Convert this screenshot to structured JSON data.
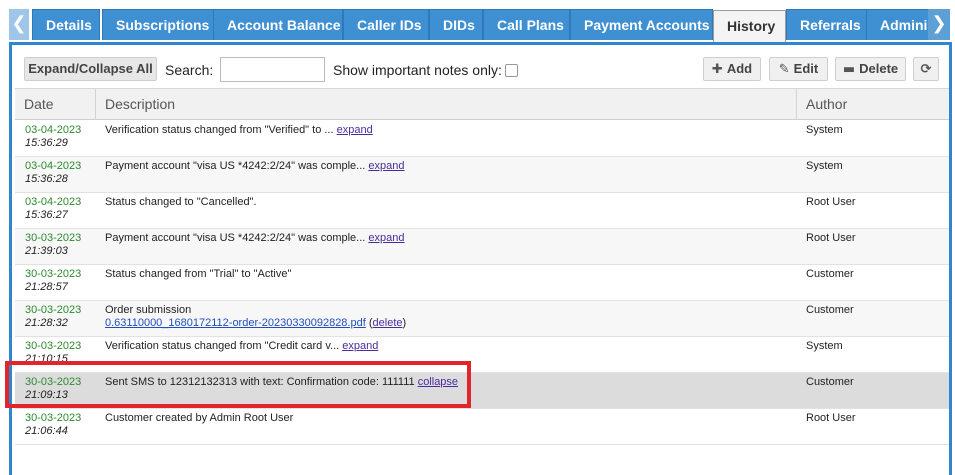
{
  "tabs": [
    {
      "label": "Details",
      "active": false
    },
    {
      "label": "Subscriptions",
      "active": false
    },
    {
      "label": "Account Balance",
      "active": false
    },
    {
      "label": "Caller IDs",
      "active": false
    },
    {
      "label": "DIDs",
      "active": false
    },
    {
      "label": "Call Plans",
      "active": false
    },
    {
      "label": "Payment Accounts",
      "active": false
    },
    {
      "label": "History",
      "active": true
    },
    {
      "label": "Referrals",
      "active": false
    },
    {
      "label": "Adminis",
      "active": false
    }
  ],
  "nav": {
    "left_icon": "chevron-left-icon",
    "left_glyph": "❮",
    "right_icon": "chevron-right-icon",
    "right_glyph": "❯"
  },
  "toolbar": {
    "expand_label": "Expand/Collapse All",
    "search_label": "Search:",
    "search_value": "",
    "important_label": "Show important notes only:",
    "important_checked": false,
    "add_label": "Add",
    "edit_label": "Edit",
    "delete_label": "Delete",
    "add_icon": "plus-icon",
    "edit_icon": "pencil-icon",
    "delete_icon": "minus-icon",
    "refresh_icon": "refresh-icon"
  },
  "grid": {
    "columns": [
      "Date",
      "Description",
      "Author"
    ],
    "rows": [
      {
        "date": "03-04-2023",
        "time": "15:36:29",
        "text": "Verification status changed from \"Verified\" to ... ",
        "link": "expand",
        "author": "System"
      },
      {
        "date": "03-04-2023",
        "time": "15:36:28",
        "text": "Payment account \"visa US *4242:2/24\" was comple... ",
        "link": "expand",
        "author": "System"
      },
      {
        "date": "03-04-2023",
        "time": "15:36:27",
        "text": "Status changed to \"Cancelled\".",
        "link": "",
        "author": "Root User"
      },
      {
        "date": "30-03-2023",
        "time": "21:39:03",
        "text": "Payment account \"visa US *4242:2/24\" was comple... ",
        "link": "expand",
        "author": "Root User"
      },
      {
        "date": "30-03-2023",
        "time": "21:28:57",
        "text": "Status changed from \"Trial\" to \"Active\"",
        "link": "",
        "author": "Customer"
      },
      {
        "date": "30-03-2023",
        "time": "21:28:32",
        "text": "Order submission",
        "file": "0.63110000_1680172112-order-20230330092828.pdf",
        "file_suffix_open": " (",
        "file_delete": "delete",
        "file_suffix_close": ")",
        "author": "Customer"
      },
      {
        "date": "30-03-2023",
        "time": "21:10:15",
        "text": "Verification status changed from \"Credit card v... ",
        "link": "expand",
        "author": "System"
      },
      {
        "date": "30-03-2023",
        "time": "21:09:13",
        "text": "Sent SMS to 12312132313 with text: Confirmation code: 111111 ",
        "link": "collapse",
        "author": "Customer",
        "selected": true
      },
      {
        "date": "30-03-2023",
        "time": "21:06:44",
        "text": "Customer created by Admin Root User",
        "link": "",
        "author": "Root User"
      }
    ]
  },
  "colors": {
    "tab_bg": "#3f8fd3",
    "panel_border": "#2f86cf",
    "date_green": "#2d8a2d",
    "highlight_red": "#e0252b",
    "selected_row": "#dcdcdc"
  }
}
